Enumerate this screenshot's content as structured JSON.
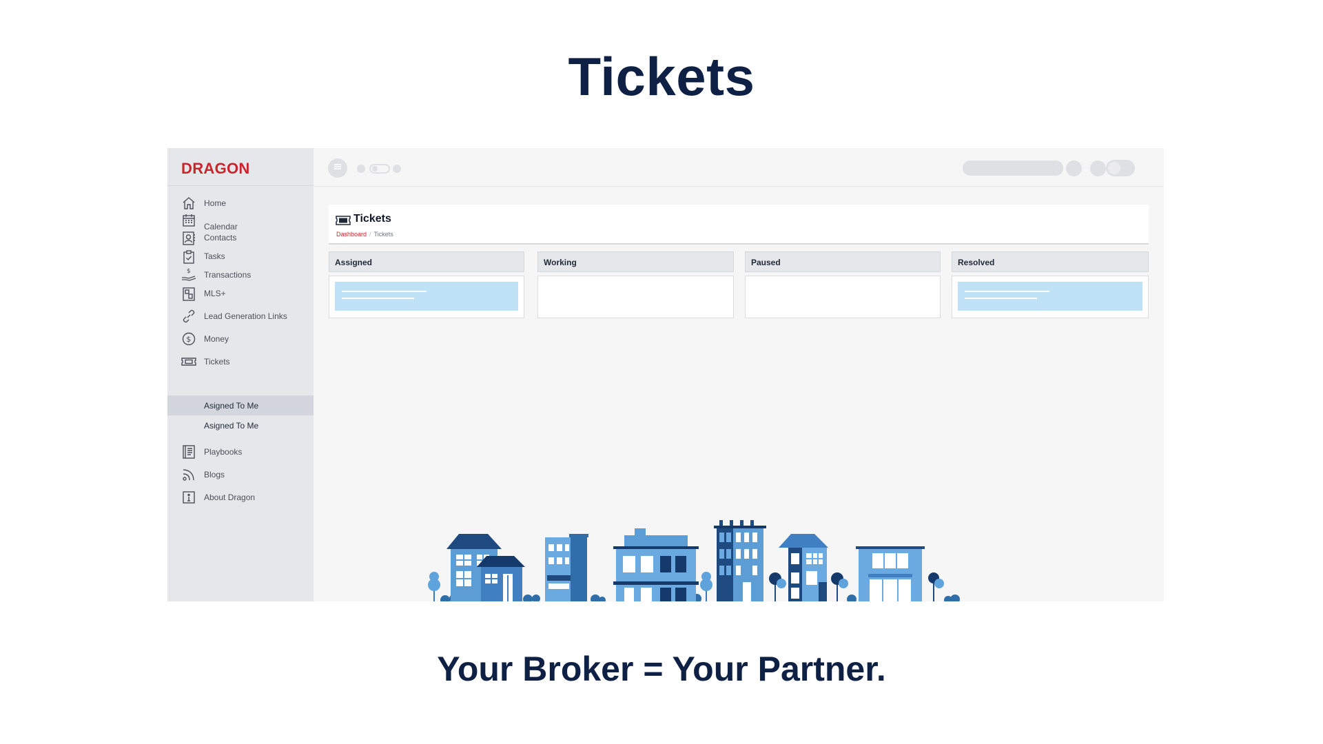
{
  "slide": {
    "title": "Tickets",
    "tagline": "Your Broker = Your Partner."
  },
  "app": {
    "brand": "DRAGON",
    "sidebar": {
      "items": [
        {
          "label": "Home",
          "icon": "home-icon"
        },
        {
          "label": "Calendar",
          "icon": "calendar-icon"
        },
        {
          "label": "Contacts",
          "icon": "contacts-icon"
        },
        {
          "label": "Tasks",
          "icon": "clipboard-check-icon"
        },
        {
          "label": "Transactions",
          "icon": "hand-dollar-icon"
        },
        {
          "label": "MLS+",
          "icon": "mls-icon"
        },
        {
          "label": "Lead Generation Links",
          "icon": "link-icon"
        },
        {
          "label": "Money",
          "icon": "dollar-circle-icon"
        },
        {
          "label": "Tickets",
          "icon": "ticket-icon"
        }
      ],
      "sub_items": [
        {
          "label": "Asigned To Me",
          "active": true
        },
        {
          "label": "Asigned To Me",
          "active": false
        }
      ],
      "bottom_items": [
        {
          "label": "Playbooks",
          "icon": "book-icon"
        },
        {
          "label": "Blogs",
          "icon": "rss-icon"
        },
        {
          "label": "About Dragon",
          "icon": "info-icon"
        }
      ]
    },
    "page": {
      "title": "Tickets",
      "breadcrumb": [
        "Dashboard",
        "Tickets"
      ],
      "separator": "/"
    },
    "columns": [
      {
        "name": "Assigned",
        "has_card": true
      },
      {
        "name": "Working",
        "has_card": false
      },
      {
        "name": "Paused",
        "has_card": false
      },
      {
        "name": "Resolved",
        "has_card": true
      }
    ],
    "colors": {
      "brand_red": "#c8262c",
      "navy": "#0e2044",
      "card_blue": "#bfe2f6",
      "sidebar_bg": "#e6e7ea"
    }
  }
}
